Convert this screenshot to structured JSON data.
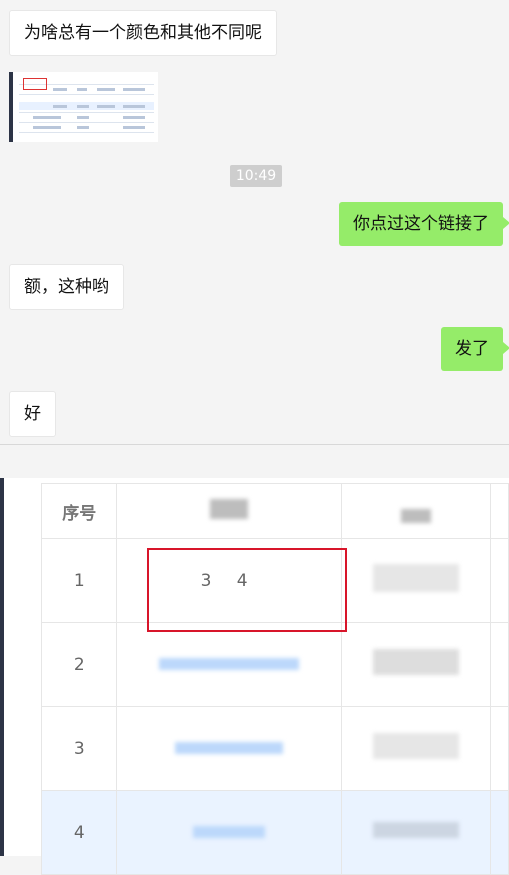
{
  "messages": [
    {
      "side": "left",
      "text": "为啥总有一个颜色和其他不同呢"
    },
    {
      "side": "right",
      "text": "你点过这个链接了"
    },
    {
      "side": "left",
      "text": "额，这种哟"
    },
    {
      "side": "right",
      "text": "发了"
    },
    {
      "side": "left",
      "text": "好"
    }
  ],
  "timestamp": "10:49",
  "table": {
    "header_index": "序号",
    "rows": [
      {
        "index": "1",
        "value": "3 4"
      },
      {
        "index": "2",
        "value": ""
      },
      {
        "index": "3",
        "value": ""
      },
      {
        "index": "4",
        "value": ""
      }
    ],
    "highlight_color": "#eaf3ff",
    "annotation_color": "#d8152a"
  }
}
